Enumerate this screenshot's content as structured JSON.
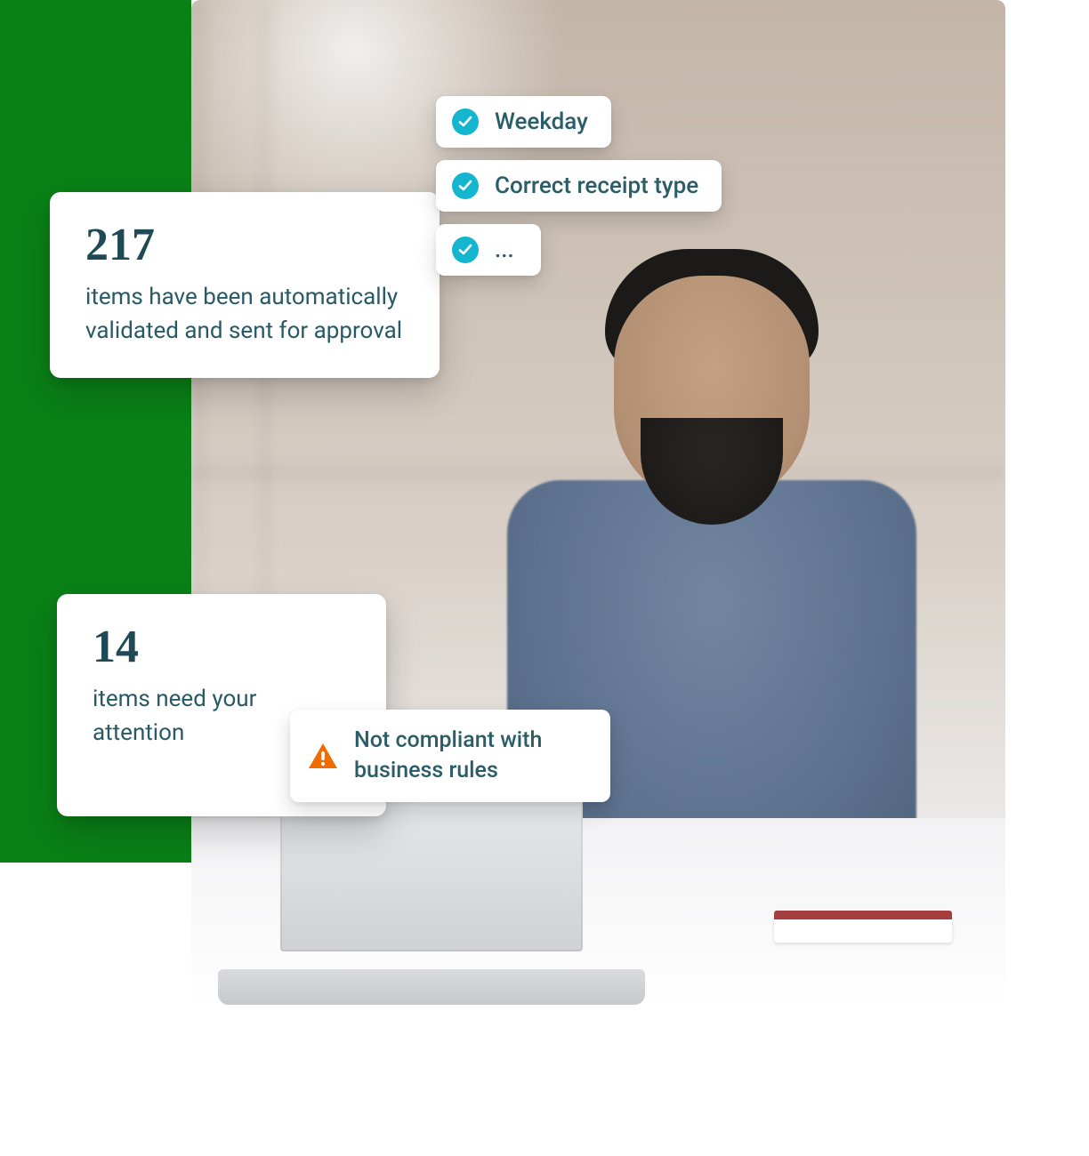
{
  "validated_card": {
    "count": "217",
    "text": "items have been automatically validated and sent for approval"
  },
  "attention_card": {
    "count": "14",
    "text": "items need your attention"
  },
  "pills": {
    "weekday": "Weekday",
    "receipt_type": "Correct receipt type",
    "ellipsis": "...",
    "noncompliant": "Not compliant with business rules"
  },
  "colors": {
    "accent_green": "#0a8017",
    "check_teal": "#14b6cf",
    "warn_orange": "#ef6c00",
    "text_teal": "#285a66"
  }
}
